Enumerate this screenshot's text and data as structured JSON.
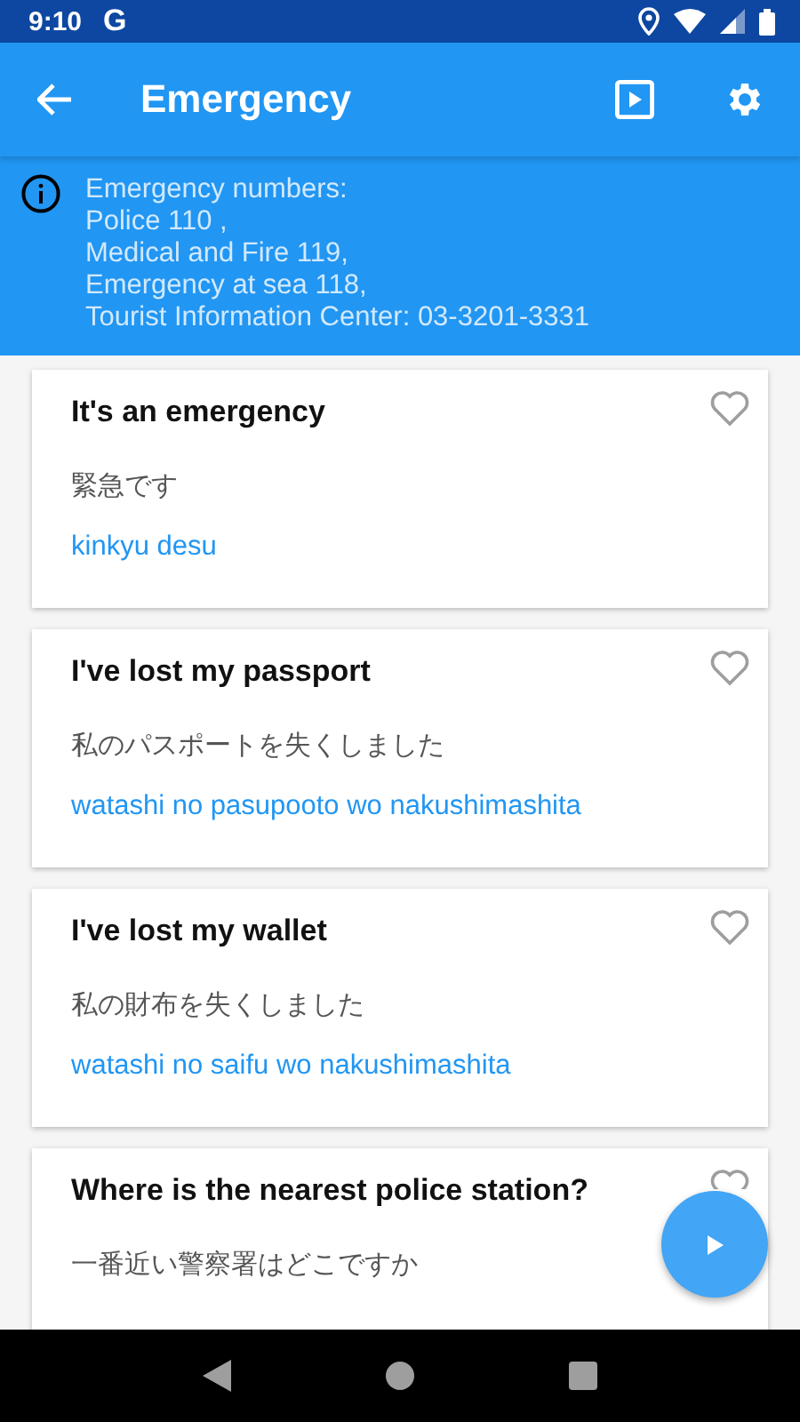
{
  "status_bar": {
    "time": "9:10",
    "app_letter": "G"
  },
  "app_bar": {
    "title": "Emergency"
  },
  "info": {
    "lines": [
      "Emergency numbers:",
      "Police 110 ,",
      "Medical and Fire 119,",
      "Emergency at sea 118,",
      "Tourist Information Center: 03-3201-3331"
    ]
  },
  "phrases": [
    {
      "english": "It's an emergency",
      "japanese": "緊急です",
      "romaji": "kinkyu desu",
      "favorite": false
    },
    {
      "english": "I've lost my passport",
      "japanese": "私のパスポートを失くしました",
      "romaji": "watashi no pasupooto wo nakushimashita",
      "favorite": false
    },
    {
      "english": "I've lost my wallet",
      "japanese": "私の財布を失くしました",
      "romaji": "watashi no saifu wo nakushimashita",
      "favorite": false
    },
    {
      "english": "Where is the nearest police station?",
      "japanese": "一番近い警察署はどこですか",
      "favorite": false
    }
  ]
}
